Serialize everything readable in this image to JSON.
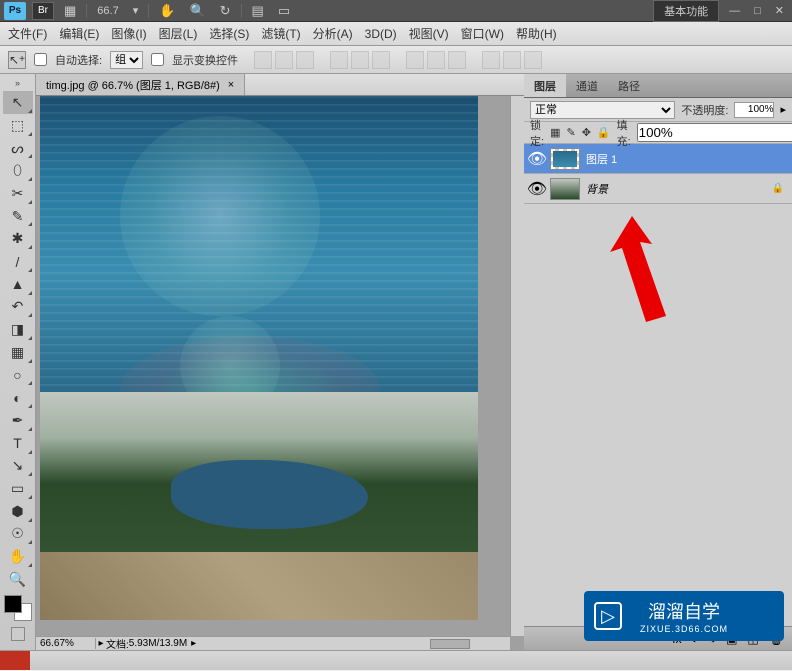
{
  "topbar": {
    "ps_label": "Ps",
    "br_label": "Br",
    "zoom": "66.7",
    "workspace": "基本功能"
  },
  "menus": {
    "file": "文件(F)",
    "edit": "编辑(E)",
    "image": "图像(I)",
    "layer": "图层(L)",
    "select": "选择(S)",
    "filter": "滤镜(T)",
    "analyze": "分析(A)",
    "threed": "3D(D)",
    "view": "视图(V)",
    "window": "窗口(W)",
    "help": "帮助(H)"
  },
  "options": {
    "auto_select_label": "自动选择:",
    "auto_select_value": "组",
    "show_transform": "显示变换控件"
  },
  "doc": {
    "tab_title": "timg.jpg @ 66.7% (图层 1, RGB/8#)",
    "zoom": "66.67%",
    "doc_label": "文档:",
    "doc_info": "5.93M/13.9M"
  },
  "panels": {
    "tabs": {
      "layers": "图层",
      "channels": "通道",
      "paths": "路径"
    },
    "blend_mode": "正常",
    "opacity_label": "不透明度:",
    "opacity_value": "100%",
    "lock_label": "锁定:",
    "fill_label": "填充:",
    "fill_value": "100%",
    "layers": [
      {
        "name": "图层 1",
        "selected": true,
        "locked": false
      },
      {
        "name": "背景",
        "selected": false,
        "locked": true
      }
    ]
  },
  "watermark": {
    "text": "溜溜自学",
    "sub": "ZIXUE.3D66.COM"
  }
}
